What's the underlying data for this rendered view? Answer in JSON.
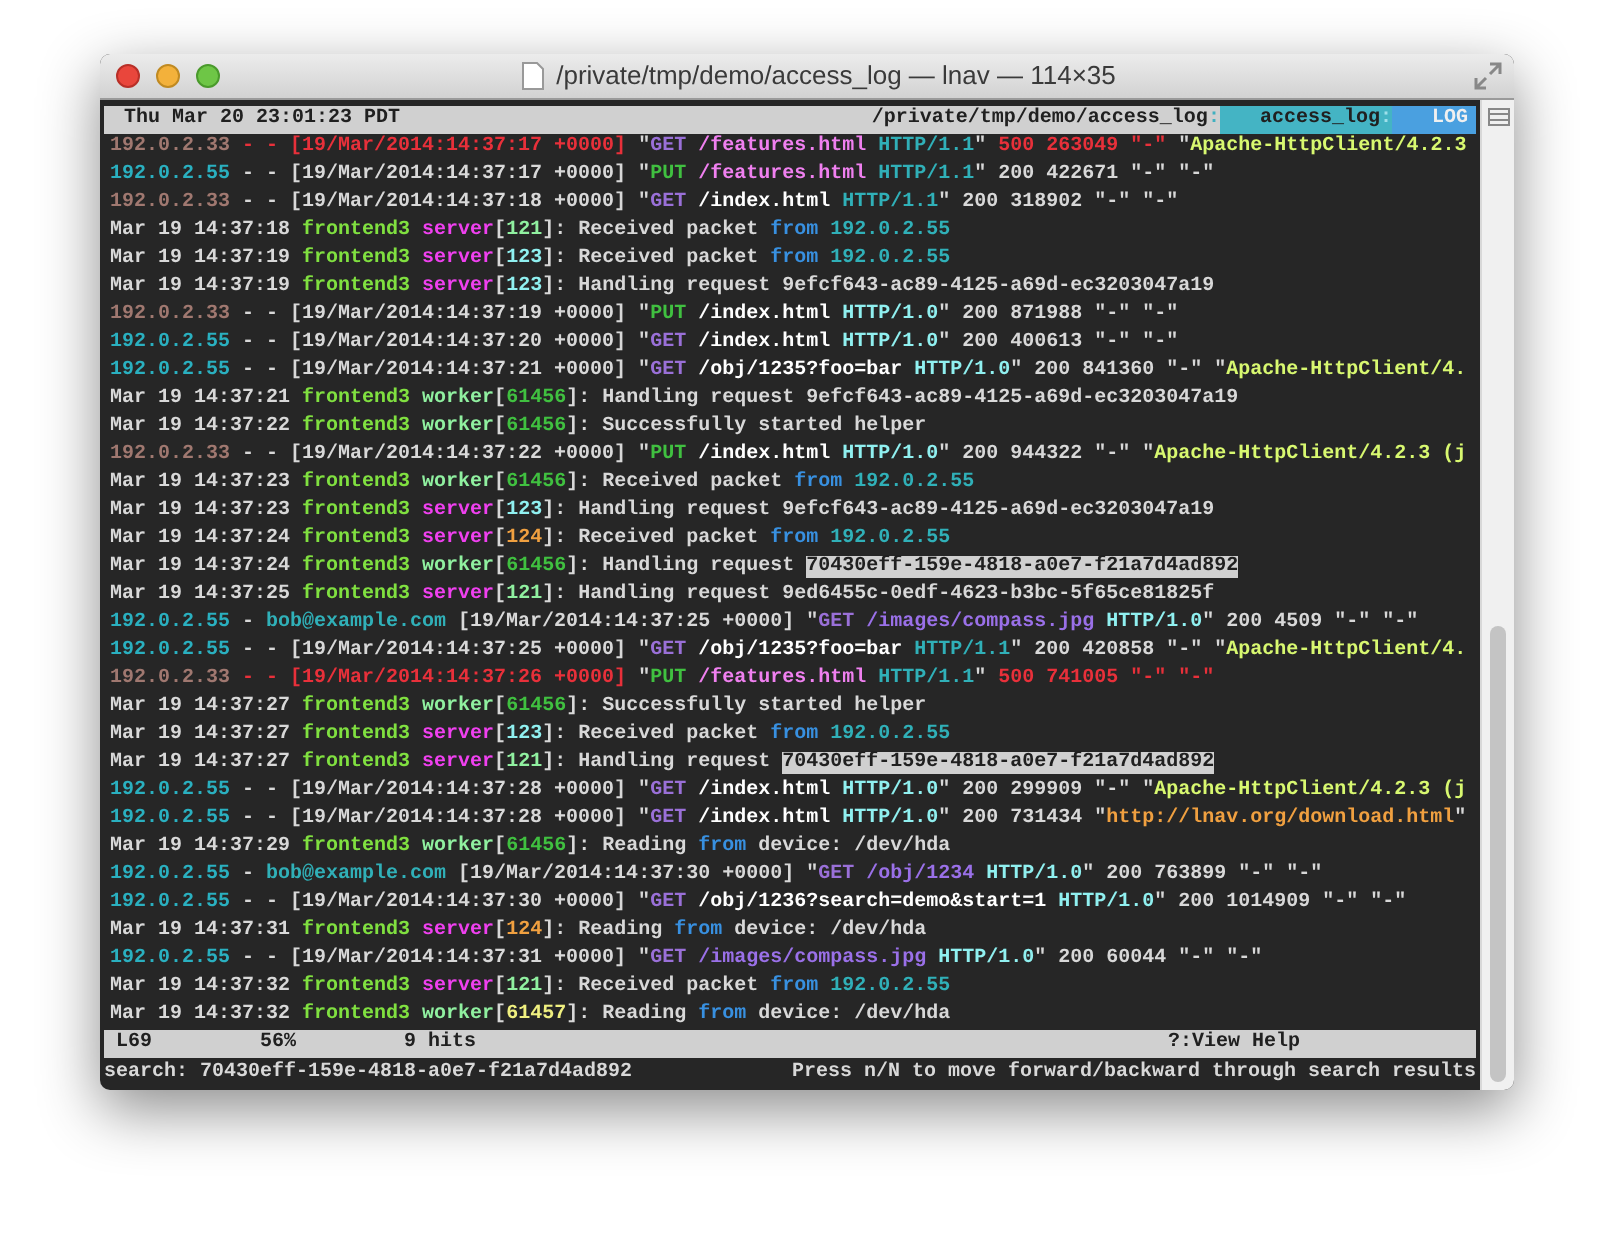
{
  "window": {
    "title": "/private/tmp/demo/access_log — lnav — 114×35"
  },
  "top_status": {
    "clock": "Thu Mar 20 23:01:23 PDT",
    "path": "/private/tmp/demo/access_log",
    "path_separator": ":",
    "file": "access_log",
    "file_separator": ":",
    "view": "LOG"
  },
  "lines": [
    {
      "search_hit": false,
      "segments": [
        {
          "text": "192.0.2.33",
          "color": "#a07870"
        },
        {
          "text": " - - [19/Mar/2014:14:37:17 +0000]",
          "color": "#e8303a"
        },
        {
          "text": " \"",
          "color": "#d8d8d8"
        },
        {
          "text": "GET",
          "color": "#9a70d8"
        },
        {
          "text": " /features.html",
          "color": "#f080f0"
        },
        {
          "text": " HTTP/1.1",
          "color": "#30b0b8"
        },
        {
          "text": "\" ",
          "color": "#d8d8d8"
        },
        {
          "text": "500 263049 \"-\" ",
          "color": "#e8303a"
        },
        {
          "text": "\"",
          "color": "#d8d8d8"
        },
        {
          "text": "Apache-HttpClient/4.2.3",
          "color": "#d8f870"
        }
      ]
    },
    {
      "search_hit": false,
      "segments": [
        {
          "text": "192.0.2.55",
          "color": "#2ab0c0"
        },
        {
          "text": " - - [19/Mar/2014:14:37:17 +0000] \"",
          "color": "#d8d8d8"
        },
        {
          "text": "PUT",
          "color": "#40c040"
        },
        {
          "text": " /features.html",
          "color": "#f080f0"
        },
        {
          "text": " HTTP/1.1",
          "color": "#30b0b8"
        },
        {
          "text": "\" 200 422671 \"-\" \"-\"",
          "color": "#d8d8d8"
        }
      ]
    },
    {
      "search_hit": false,
      "segments": [
        {
          "text": "192.0.2.33",
          "color": "#a07870"
        },
        {
          "text": " - - [19/Mar/2014:14:37:18 +0000] \"",
          "color": "#d8d8d8"
        },
        {
          "text": "GET",
          "color": "#9a70d8"
        },
        {
          "text": " /index.html",
          "color": "#ffffff"
        },
        {
          "text": " HTTP/1.1",
          "color": "#30b0b8"
        },
        {
          "text": "\" 200 318902 \"-\" \"-\"",
          "color": "#d8d8d8"
        }
      ]
    },
    {
      "search_hit": false,
      "segments": [
        {
          "text": "Mar 19 14:37:18 ",
          "color": "#d8d8d8"
        },
        {
          "text": "frontend3",
          "color": "#80e040"
        },
        {
          "text": " server",
          "color": "#f040f0"
        },
        {
          "text": "[",
          "color": "#d8d8d8"
        },
        {
          "text": "121",
          "color": "#90f0a0"
        },
        {
          "text": "]: Received packet ",
          "color": "#d8d8d8"
        },
        {
          "text": "from",
          "color": "#3890e0"
        },
        {
          "text": " 192.0.2.55",
          "color": "#30b0b8"
        }
      ]
    },
    {
      "search_hit": false,
      "segments": [
        {
          "text": "Mar 19 14:37:19 ",
          "color": "#d8d8d8"
        },
        {
          "text": "frontend3",
          "color": "#80e040"
        },
        {
          "text": " server",
          "color": "#f040f0"
        },
        {
          "text": "[",
          "color": "#d8d8d8"
        },
        {
          "text": "123",
          "color": "#90f0f0"
        },
        {
          "text": "]: Received packet ",
          "color": "#d8d8d8"
        },
        {
          "text": "from",
          "color": "#3890e0"
        },
        {
          "text": " 192.0.2.55",
          "color": "#30b0b8"
        }
      ]
    },
    {
      "search_hit": false,
      "segments": [
        {
          "text": "Mar 19 14:37:19 ",
          "color": "#d8d8d8"
        },
        {
          "text": "frontend3",
          "color": "#80e040"
        },
        {
          "text": " server",
          "color": "#f040f0"
        },
        {
          "text": "[",
          "color": "#d8d8d8"
        },
        {
          "text": "123",
          "color": "#90f0f0"
        },
        {
          "text": "]: Handling request 9efcf643-ac89-4125-a69d-ec3203047a19",
          "color": "#d8d8d8"
        }
      ]
    },
    {
      "search_hit": false,
      "segments": [
        {
          "text": "192.0.2.33",
          "color": "#a07870"
        },
        {
          "text": " - - [19/Mar/2014:14:37:19 +0000] \"",
          "color": "#d8d8d8"
        },
        {
          "text": "PUT",
          "color": "#40c040"
        },
        {
          "text": " /index.html",
          "color": "#ffffff"
        },
        {
          "text": " HTTP/1.0",
          "color": "#90f0f0"
        },
        {
          "text": "\" 200 871988 \"-\" \"-\"",
          "color": "#d8d8d8"
        }
      ]
    },
    {
      "search_hit": false,
      "segments": [
        {
          "text": "192.0.2.55",
          "color": "#2ab0c0"
        },
        {
          "text": " - - [19/Mar/2014:14:37:20 +0000] \"",
          "color": "#d8d8d8"
        },
        {
          "text": "GET",
          "color": "#9a70d8"
        },
        {
          "text": " /index.html",
          "color": "#ffffff"
        },
        {
          "text": " HTTP/1.0",
          "color": "#90f0f0"
        },
        {
          "text": "\" 200 400613 \"-\" \"-\"",
          "color": "#d8d8d8"
        }
      ]
    },
    {
      "search_hit": false,
      "segments": [
        {
          "text": "192.0.2.55",
          "color": "#2ab0c0"
        },
        {
          "text": " - - [19/Mar/2014:14:37:21 +0000] \"",
          "color": "#d8d8d8"
        },
        {
          "text": "GET",
          "color": "#9a70d8"
        },
        {
          "text": " /obj/1235?foo=bar",
          "color": "#ffffff"
        },
        {
          "text": " HTTP/1.0",
          "color": "#90f0f0"
        },
        {
          "text": "\" 200 841360 \"-\" \"",
          "color": "#d8d8d8"
        },
        {
          "text": "Apache-HttpClient/4.",
          "color": "#d8f870"
        }
      ]
    },
    {
      "search_hit": false,
      "segments": [
        {
          "text": "Mar 19 14:37:21 ",
          "color": "#d8d8d8"
        },
        {
          "text": "frontend3",
          "color": "#80e040"
        },
        {
          "text": " worker",
          "color": "#90f0a0"
        },
        {
          "text": "[",
          "color": "#d8d8d8"
        },
        {
          "text": "61456",
          "color": "#40c040"
        },
        {
          "text": "]: Handling request 9efcf643-ac89-4125-a69d-ec3203047a19",
          "color": "#d8d8d8"
        }
      ]
    },
    {
      "search_hit": false,
      "segments": [
        {
          "text": "Mar 19 14:37:22 ",
          "color": "#d8d8d8"
        },
        {
          "text": "frontend3",
          "color": "#80e040"
        },
        {
          "text": " worker",
          "color": "#90f0a0"
        },
        {
          "text": "[",
          "color": "#d8d8d8"
        },
        {
          "text": "61456",
          "color": "#40c040"
        },
        {
          "text": "]: Successfully started helper",
          "color": "#d8d8d8"
        }
      ]
    },
    {
      "search_hit": false,
      "segments": [
        {
          "text": "192.0.2.33",
          "color": "#a07870"
        },
        {
          "text": " - - [19/Mar/2014:14:37:22 +0000] \"",
          "color": "#d8d8d8"
        },
        {
          "text": "PUT",
          "color": "#40c040"
        },
        {
          "text": " /index.html",
          "color": "#ffffff"
        },
        {
          "text": " HTTP/1.0",
          "color": "#90f0f0"
        },
        {
          "text": "\" 200 944322 \"-\" \"",
          "color": "#d8d8d8"
        },
        {
          "text": "Apache-HttpClient/4.2.3 (j",
          "color": "#d8f870"
        }
      ]
    },
    {
      "search_hit": false,
      "segments": [
        {
          "text": "Mar 19 14:37:23 ",
          "color": "#d8d8d8"
        },
        {
          "text": "frontend3",
          "color": "#80e040"
        },
        {
          "text": " worker",
          "color": "#90f0a0"
        },
        {
          "text": "[",
          "color": "#d8d8d8"
        },
        {
          "text": "61456",
          "color": "#40c040"
        },
        {
          "text": "]: Received packet ",
          "color": "#d8d8d8"
        },
        {
          "text": "from",
          "color": "#3890e0"
        },
        {
          "text": " 192.0.2.55",
          "color": "#30b0b8"
        }
      ]
    },
    {
      "search_hit": false,
      "segments": [
        {
          "text": "Mar 19 14:37:23 ",
          "color": "#d8d8d8"
        },
        {
          "text": "frontend3",
          "color": "#80e040"
        },
        {
          "text": " server",
          "color": "#f040f0"
        },
        {
          "text": "[",
          "color": "#d8d8d8"
        },
        {
          "text": "123",
          "color": "#90f0f0"
        },
        {
          "text": "]: Handling request 9efcf643-ac89-4125-a69d-ec3203047a19",
          "color": "#d8d8d8"
        }
      ]
    },
    {
      "search_hit": false,
      "segments": [
        {
          "text": "Mar 19 14:37:24 ",
          "color": "#d8d8d8"
        },
        {
          "text": "frontend3",
          "color": "#80e040"
        },
        {
          "text": " server",
          "color": "#f040f0"
        },
        {
          "text": "[",
          "color": "#d8d8d8"
        },
        {
          "text": "124",
          "color": "#f0a040"
        },
        {
          "text": "]: Received packet ",
          "color": "#d8d8d8"
        },
        {
          "text": "from",
          "color": "#3890e0"
        },
        {
          "text": " 192.0.2.55",
          "color": "#30b0b8"
        }
      ]
    },
    {
      "search_hit": true,
      "segments": [
        {
          "text": "Mar 19 14:37:24 ",
          "color": "#d8d8d8"
        },
        {
          "text": "frontend3",
          "color": "#80e040"
        },
        {
          "text": " worker",
          "color": "#90f0a0"
        },
        {
          "text": "[",
          "color": "#d8d8d8"
        },
        {
          "text": "61456",
          "color": "#40c040"
        },
        {
          "text": "]: Handling request ",
          "color": "#d8d8d8"
        },
        {
          "text": "70430eff-159e-4818-a0e7-f21a7d4ad892",
          "color": "#202020"
        }
      ]
    },
    {
      "search_hit": false,
      "segments": [
        {
          "text": "Mar 19 14:37:25 ",
          "color": "#d8d8d8"
        },
        {
          "text": "frontend3",
          "color": "#80e040"
        },
        {
          "text": " server",
          "color": "#f040f0"
        },
        {
          "text": "[",
          "color": "#d8d8d8"
        },
        {
          "text": "121",
          "color": "#90f0a0"
        },
        {
          "text": "]: Handling request 9ed6455c-0edf-4623-b3bc-5f65ce81825f",
          "color": "#d8d8d8"
        }
      ]
    },
    {
      "search_hit": false,
      "segments": [
        {
          "text": "192.0.2.55",
          "color": "#2ab0c0"
        },
        {
          "text": " - ",
          "color": "#d8d8d8"
        },
        {
          "text": "bob@example.com",
          "color": "#30b0b8"
        },
        {
          "text": " [19/Mar/2014:14:37:25 +0000] \"",
          "color": "#d8d8d8"
        },
        {
          "text": "GET",
          "color": "#9a70d8"
        },
        {
          "text": " /images/compass.jpg",
          "color": "#9a70e8"
        },
        {
          "text": " HTTP/1.0",
          "color": "#90f0f0"
        },
        {
          "text": "\" 200 4509 \"-\" \"-\"",
          "color": "#d8d8d8"
        }
      ]
    },
    {
      "search_hit": false,
      "segments": [
        {
          "text": "192.0.2.55",
          "color": "#2ab0c0"
        },
        {
          "text": " - - [19/Mar/2014:14:37:25 +0000] \"",
          "color": "#d8d8d8"
        },
        {
          "text": "GET",
          "color": "#9a70d8"
        },
        {
          "text": " /obj/1235?foo=bar",
          "color": "#ffffff"
        },
        {
          "text": " HTTP/1.1",
          "color": "#30b0b8"
        },
        {
          "text": "\" 200 420858 \"-\" \"",
          "color": "#d8d8d8"
        },
        {
          "text": "Apache-HttpClient/4.",
          "color": "#d8f870"
        }
      ]
    },
    {
      "search_hit": false,
      "segments": [
        {
          "text": "192.0.2.33",
          "color": "#a07870"
        },
        {
          "text": " - - [19/Mar/2014:14:37:26 +0000]",
          "color": "#e8303a"
        },
        {
          "text": " \"",
          "color": "#d8d8d8"
        },
        {
          "text": "PUT",
          "color": "#40c040"
        },
        {
          "text": " /features.html",
          "color": "#f080f0"
        },
        {
          "text": " HTTP/1.1",
          "color": "#30b0b8"
        },
        {
          "text": "\" ",
          "color": "#d8d8d8"
        },
        {
          "text": "500 741005 \"-\" \"-\"",
          "color": "#e8303a"
        }
      ]
    },
    {
      "search_hit": false,
      "segments": [
        {
          "text": "Mar 19 14:37:27 ",
          "color": "#d8d8d8"
        },
        {
          "text": "frontend3",
          "color": "#80e040"
        },
        {
          "text": " worker",
          "color": "#90f0a0"
        },
        {
          "text": "[",
          "color": "#d8d8d8"
        },
        {
          "text": "61456",
          "color": "#40c040"
        },
        {
          "text": "]: Successfully started helper",
          "color": "#d8d8d8"
        }
      ]
    },
    {
      "search_hit": false,
      "segments": [
        {
          "text": "Mar 19 14:37:27 ",
          "color": "#d8d8d8"
        },
        {
          "text": "frontend3",
          "color": "#80e040"
        },
        {
          "text": " server",
          "color": "#f040f0"
        },
        {
          "text": "[",
          "color": "#d8d8d8"
        },
        {
          "text": "123",
          "color": "#90f0f0"
        },
        {
          "text": "]: Received packet ",
          "color": "#d8d8d8"
        },
        {
          "text": "from",
          "color": "#3890e0"
        },
        {
          "text": " 192.0.2.55",
          "color": "#30b0b8"
        }
      ]
    },
    {
      "search_hit": true,
      "segments": [
        {
          "text": "Mar 19 14:37:27 ",
          "color": "#d8d8d8"
        },
        {
          "text": "frontend3",
          "color": "#80e040"
        },
        {
          "text": " server",
          "color": "#f040f0"
        },
        {
          "text": "[",
          "color": "#d8d8d8"
        },
        {
          "text": "121",
          "color": "#90f0a0"
        },
        {
          "text": "]: Handling request ",
          "color": "#d8d8d8"
        },
        {
          "text": "70430eff-159e-4818-a0e7-f21a7d4ad892",
          "color": "#202020"
        }
      ]
    },
    {
      "search_hit": false,
      "segments": [
        {
          "text": "192.0.2.55",
          "color": "#2ab0c0"
        },
        {
          "text": " - - [19/Mar/2014:14:37:28 +0000] \"",
          "color": "#d8d8d8"
        },
        {
          "text": "GET",
          "color": "#9a70d8"
        },
        {
          "text": " /index.html",
          "color": "#ffffff"
        },
        {
          "text": " HTTP/1.0",
          "color": "#90f0f0"
        },
        {
          "text": "\" 200 299909 \"-\" \"",
          "color": "#d8d8d8"
        },
        {
          "text": "Apache-HttpClient/4.2.3 (j",
          "color": "#d8f870"
        }
      ]
    },
    {
      "search_hit": false,
      "segments": [
        {
          "text": "192.0.2.55",
          "color": "#2ab0c0"
        },
        {
          "text": " - - [19/Mar/2014:14:37:28 +0000] \"",
          "color": "#d8d8d8"
        },
        {
          "text": "GET",
          "color": "#9a70d8"
        },
        {
          "text": " /index.html",
          "color": "#ffffff"
        },
        {
          "text": " HTTP/1.0",
          "color": "#90f0f0"
        },
        {
          "text": "\" 200 731434 \"",
          "color": "#d8d8d8"
        },
        {
          "text": "http://lnav.org/download.html",
          "color": "#f0a040"
        },
        {
          "text": "\"",
          "color": "#d8d8d8"
        }
      ]
    },
    {
      "search_hit": false,
      "segments": [
        {
          "text": "Mar 19 14:37:29 ",
          "color": "#d8d8d8"
        },
        {
          "text": "frontend3",
          "color": "#80e040"
        },
        {
          "text": " worker",
          "color": "#90f0a0"
        },
        {
          "text": "[",
          "color": "#d8d8d8"
        },
        {
          "text": "61456",
          "color": "#40c040"
        },
        {
          "text": "]: Reading ",
          "color": "#d8d8d8"
        },
        {
          "text": "from",
          "color": "#3890e0"
        },
        {
          "text": " device: /dev/hda",
          "color": "#d8d8d8"
        }
      ]
    },
    {
      "search_hit": false,
      "segments": [
        {
          "text": "192.0.2.55",
          "color": "#2ab0c0"
        },
        {
          "text": " - ",
          "color": "#d8d8d8"
        },
        {
          "text": "bob@example.com",
          "color": "#30b0b8"
        },
        {
          "text": " [19/Mar/2014:14:37:30 +0000] \"",
          "color": "#d8d8d8"
        },
        {
          "text": "GET",
          "color": "#9a70d8"
        },
        {
          "text": " /obj/1234",
          "color": "#9a70e8"
        },
        {
          "text": " HTTP/1.0",
          "color": "#90f0f0"
        },
        {
          "text": "\" 200 763899 \"-\" \"-\"",
          "color": "#d8d8d8"
        }
      ]
    },
    {
      "search_hit": false,
      "segments": [
        {
          "text": "192.0.2.55",
          "color": "#2ab0c0"
        },
        {
          "text": " - - [19/Mar/2014:14:37:30 +0000] \"",
          "color": "#d8d8d8"
        },
        {
          "text": "GET",
          "color": "#9a70d8"
        },
        {
          "text": " /obj/1236?search=demo&start=1",
          "color": "#ffffff"
        },
        {
          "text": " HTTP/1.0",
          "color": "#90f0f0"
        },
        {
          "text": "\" 200 1014909 \"-\" \"-\"",
          "color": "#d8d8d8"
        }
      ]
    },
    {
      "search_hit": false,
      "segments": [
        {
          "text": "Mar 19 14:37:31 ",
          "color": "#d8d8d8"
        },
        {
          "text": "frontend3",
          "color": "#80e040"
        },
        {
          "text": " server",
          "color": "#f040f0"
        },
        {
          "text": "[",
          "color": "#d8d8d8"
        },
        {
          "text": "124",
          "color": "#f0a040"
        },
        {
          "text": "]: Reading ",
          "color": "#d8d8d8"
        },
        {
          "text": "from",
          "color": "#3890e0"
        },
        {
          "text": " device: /dev/hda",
          "color": "#d8d8d8"
        }
      ]
    },
    {
      "search_hit": false,
      "segments": [
        {
          "text": "192.0.2.55",
          "color": "#2ab0c0"
        },
        {
          "text": " - - [19/Mar/2014:14:37:31 +0000] \"",
          "color": "#d8d8d8"
        },
        {
          "text": "GET",
          "color": "#9a70d8"
        },
        {
          "text": " /images/compass.jpg",
          "color": "#9a70e8"
        },
        {
          "text": " HTTP/1.0",
          "color": "#90f0f0"
        },
        {
          "text": "\" 200 60044 \"-\" \"-\"",
          "color": "#d8d8d8"
        }
      ]
    },
    {
      "search_hit": false,
      "segments": [
        {
          "text": "Mar 19 14:37:32 ",
          "color": "#d8d8d8"
        },
        {
          "text": "frontend3",
          "color": "#80e040"
        },
        {
          "text": " server",
          "color": "#f040f0"
        },
        {
          "text": "[",
          "color": "#d8d8d8"
        },
        {
          "text": "121",
          "color": "#90f0a0"
        },
        {
          "text": "]: Received packet ",
          "color": "#d8d8d8"
        },
        {
          "text": "from",
          "color": "#3890e0"
        },
        {
          "text": " 192.0.2.55",
          "color": "#30b0b8"
        }
      ]
    },
    {
      "search_hit": false,
      "segments": [
        {
          "text": "Mar 19 14:37:32 ",
          "color": "#d8d8d8"
        },
        {
          "text": "frontend3",
          "color": "#80e040"
        },
        {
          "text": " worker",
          "color": "#90f0a0"
        },
        {
          "text": "[",
          "color": "#d8d8d8"
        },
        {
          "text": "61457",
          "color": "#f0f080"
        },
        {
          "text": "]: Reading ",
          "color": "#d8d8d8"
        },
        {
          "text": "from",
          "color": "#3890e0"
        },
        {
          "text": " device: /dev/hda",
          "color": "#d8d8d8"
        }
      ]
    }
  ],
  "bottom_status": {
    "line": "L69",
    "percent": "56%",
    "hits": "9 hits",
    "help": "?:View Help"
  },
  "command_line": {
    "search": "search: 70430eff-159e-4818-a0e7-f21a7d4ad892",
    "hint": "Press n/N to move forward/backward through search results"
  }
}
